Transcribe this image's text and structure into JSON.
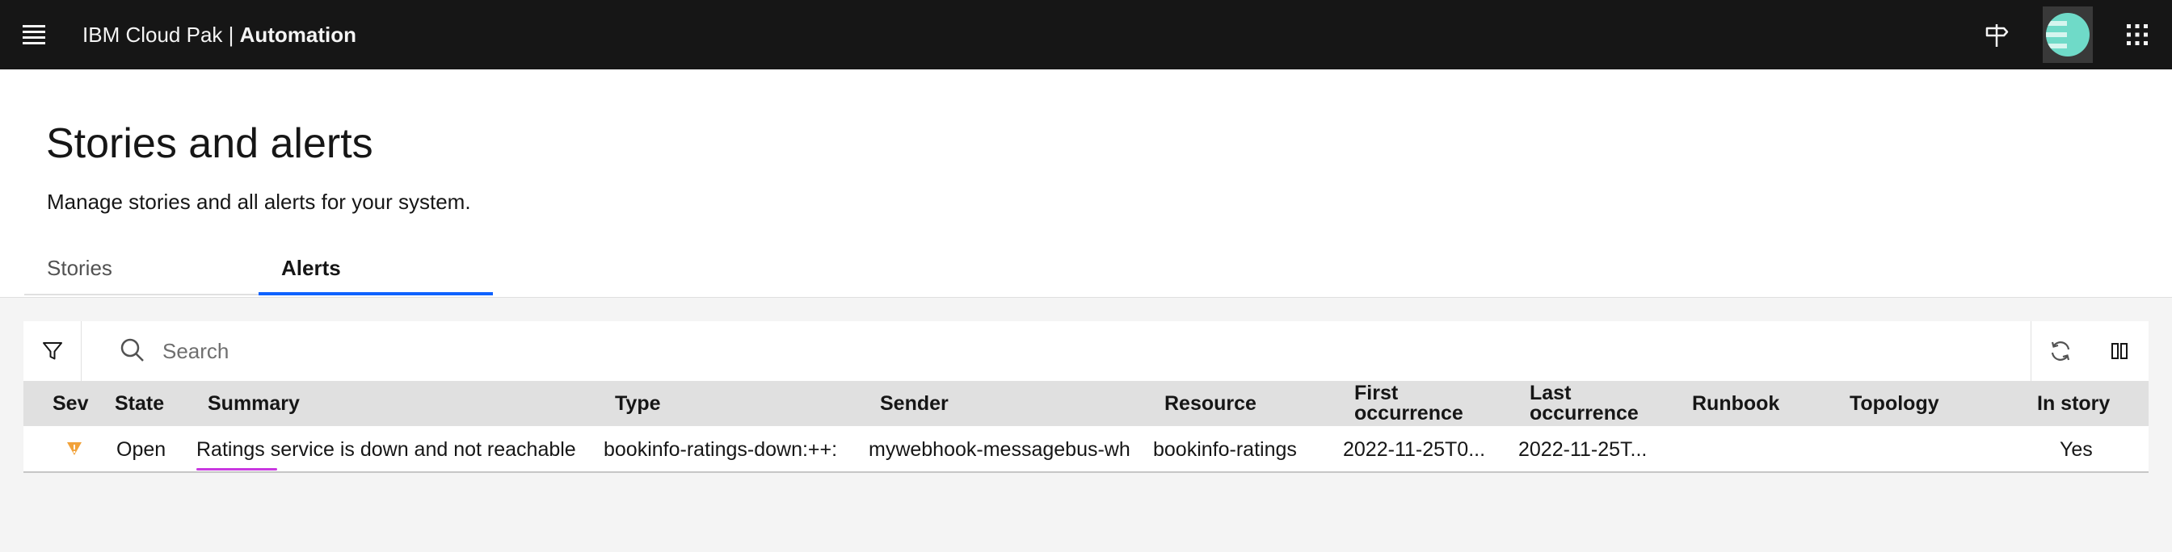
{
  "app": {
    "title_prefix": "IBM Cloud Pak | ",
    "title_product": "Automation"
  },
  "header": {
    "title": "Stories and alerts",
    "description": "Manage stories and all alerts for your system."
  },
  "tabs": [
    {
      "label": "Stories",
      "selected": false
    },
    {
      "label": "Alerts",
      "selected": true
    }
  ],
  "search": {
    "placeholder": "Search",
    "value": ""
  },
  "table": {
    "columns": {
      "sev": "Sev",
      "state": "State",
      "summary": "Summary",
      "type": "Type",
      "sender": "Sender",
      "resource": "Resource",
      "first_occurrence_1": "First",
      "first_occurrence_2": "occurrence",
      "last_occurrence_1": "Last",
      "last_occurrence_2": "occurrence",
      "runbook": "Runbook",
      "topology": "Topology",
      "in_story": "In story"
    },
    "rows": [
      {
        "severity_icon": "warning-triangle-icon",
        "state": "Open",
        "summary": "Ratings service is down and not reachable",
        "type": "bookinfo-ratings-down:++:",
        "sender": "mywebhook-messagebus-wh",
        "resource": "bookinfo-ratings",
        "first_occurrence": "2022-11-25T0...",
        "last_occurrence": "2022-11-25T...",
        "runbook": "",
        "topology": "",
        "in_story": "Yes"
      }
    ]
  },
  "icons": {
    "menu": "hamburger-menu-icon",
    "guide": "signpost-icon",
    "apps": "app-switcher-grid-icon",
    "filter": "filter-icon",
    "search": "search-icon",
    "refresh": "refresh-icon",
    "columns": "column-settings-icon"
  },
  "colors": {
    "topbar": "#161616",
    "tab_active_underline": "#0f62fe",
    "severity_warning": "#f1a23a",
    "avatar": "#6fdac8"
  }
}
